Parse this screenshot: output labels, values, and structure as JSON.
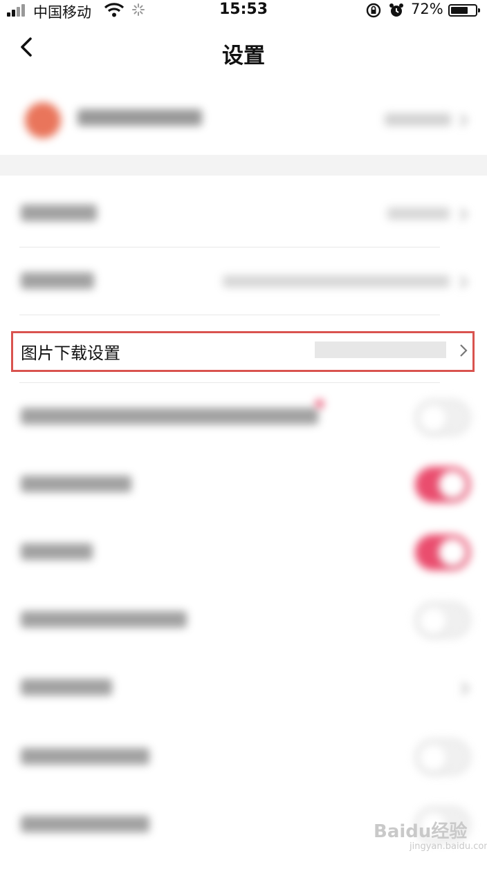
{
  "status_bar": {
    "carrier": "中国移动",
    "time": "15:53",
    "battery_percent": "72%",
    "battery_level": 0.72
  },
  "nav": {
    "title": "设置",
    "back_icon": "chevron-left-icon"
  },
  "settings": {
    "highlighted_item_label": "图片下载设置",
    "toggle_states": [
      "off",
      "on",
      "on",
      "off",
      "off",
      "off"
    ],
    "toggle_on_color": "#ea4d6e",
    "highlight_border_color": "#d9534f"
  },
  "watermark": {
    "brand": "Baidu经验",
    "url": "jingyan.baidu.com"
  }
}
